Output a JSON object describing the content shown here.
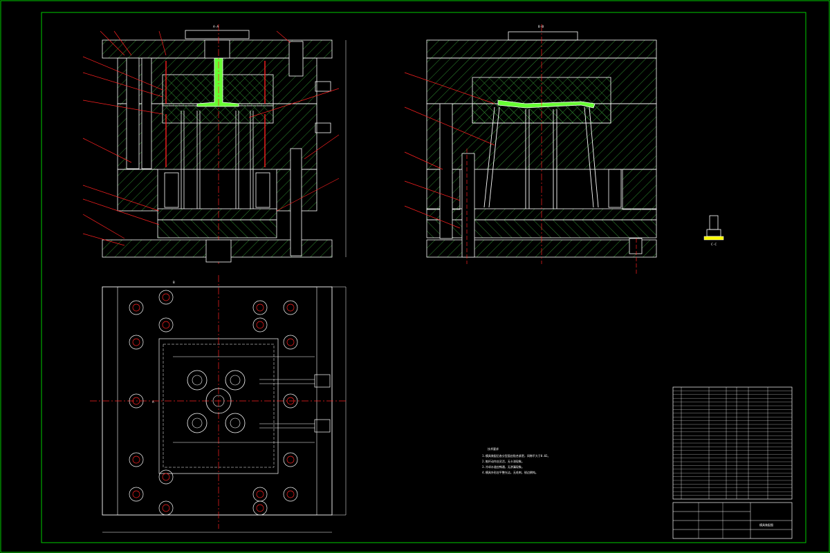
{
  "drawing": {
    "title": "模具装配图",
    "background": "#000000",
    "colors": {
      "frame": "#00cc00",
      "hatch": "#2f8a2f",
      "centerline": "#ff2020",
      "outline": "#ffffff",
      "part": "#66ff33",
      "accent": "#ffff00"
    }
  },
  "views": {
    "section_a": {
      "cut_label": "A-A"
    },
    "section_b": {
      "cut_label": "B-B"
    },
    "detail_c": {
      "cut_label": "C-C"
    },
    "plan": {
      "mark_a": "A",
      "mark_b": "B"
    }
  },
  "notes": {
    "heading": "技术要求",
    "lines": [
      "1.模具装配后各分型面应贴合紧密，间隙不大于0.02。",
      "2.推杆动作应灵活，无卡滞现象。",
      "3.冷却水道应畅通，无渗漏现象。",
      "4.模具外形应平整光洁，无毛刺，锐边倒钝。"
    ]
  },
  "bom": {
    "rows": 30
  }
}
